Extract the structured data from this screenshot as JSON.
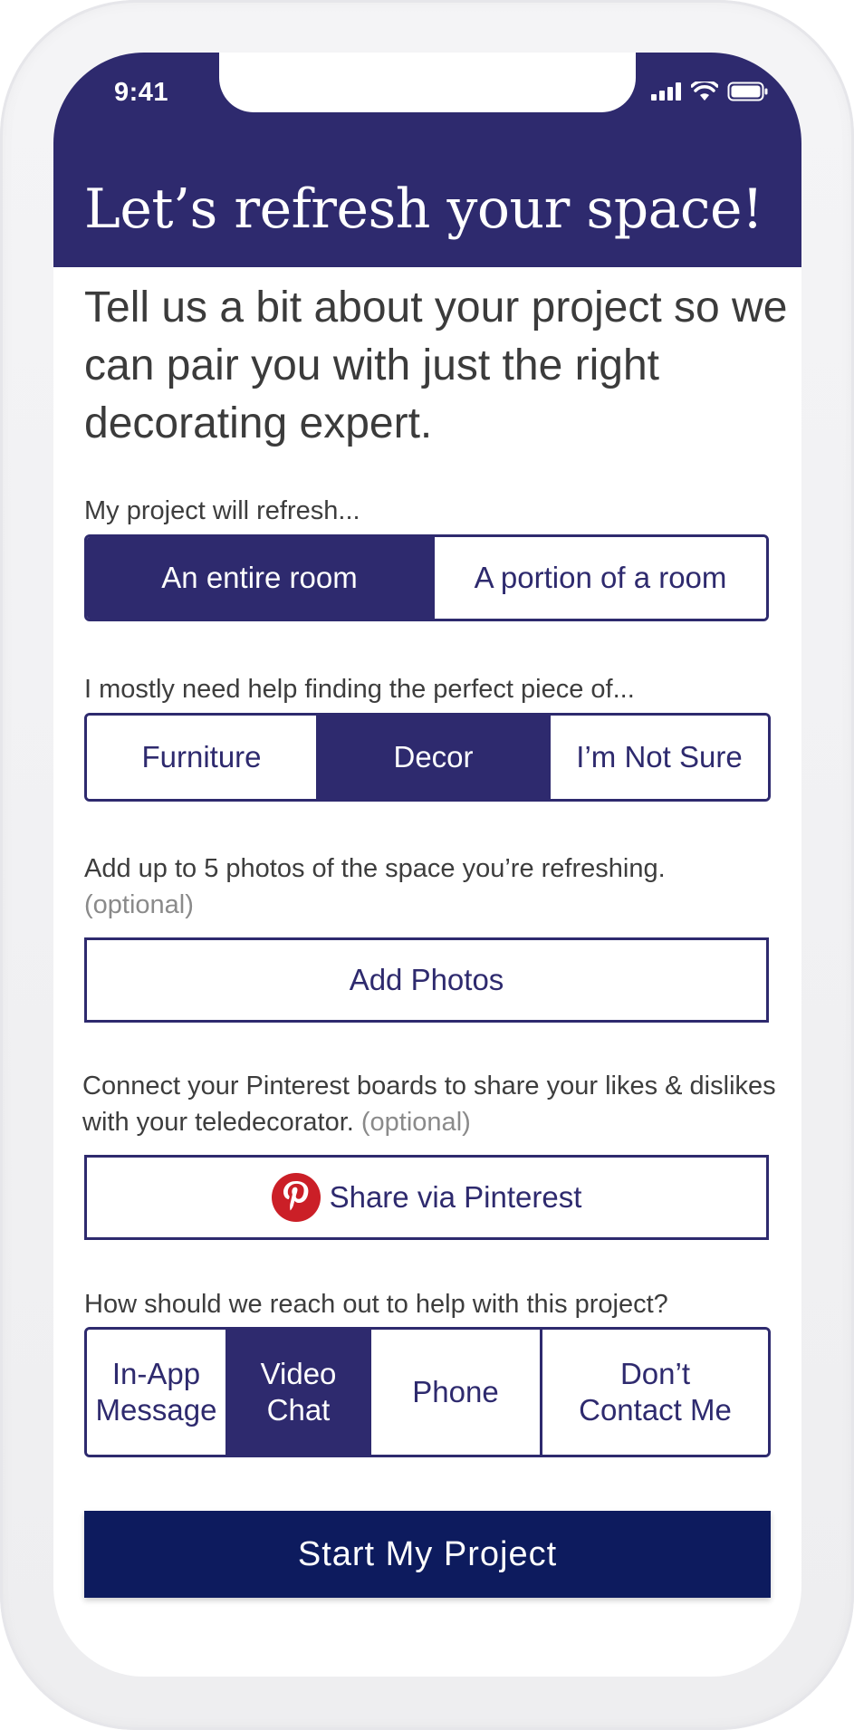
{
  "status_bar": {
    "time": "9:41"
  },
  "header": {
    "title": "Let’s refresh your space!"
  },
  "intro": "Tell us a bit about your project so we can pair you with just the right decorating expert.",
  "q1": {
    "label": "My project will refresh...",
    "options": [
      "An entire room",
      "A portion of a room"
    ],
    "selected": "An entire room"
  },
  "q2": {
    "label": "I mostly need help finding the perfect piece of...",
    "options": [
      "Furniture",
      "Decor",
      "I’m Not Sure"
    ],
    "selected": "Decor"
  },
  "photos": {
    "label": "Add up to 5 photos of the space you’re refreshing.",
    "optional": "(optional)",
    "button": "Add Photos"
  },
  "pinterest": {
    "label": "Connect your Pinterest boards to share your likes & dislikes with your teledecorator.",
    "optional": "(optional)",
    "button": "Share via Pinterest"
  },
  "contact": {
    "label": "How should we reach out to help with this project?",
    "options": [
      {
        "line1": "In-App",
        "line2": "Message"
      },
      {
        "line1": "Video",
        "line2": "Chat"
      },
      {
        "line1": "Phone",
        "line2": ""
      },
      {
        "line1": "Don’t",
        "line2": "Contact Me"
      }
    ],
    "selected": "Video Chat"
  },
  "cta": "Start My Project",
  "colors": {
    "primary": "#2e2a6e",
    "cta": "#0d1b5e",
    "pinterest": "#cb1f27"
  },
  "icons": [
    "signal-icon",
    "wifi-icon",
    "battery-icon",
    "pinterest-icon"
  ]
}
